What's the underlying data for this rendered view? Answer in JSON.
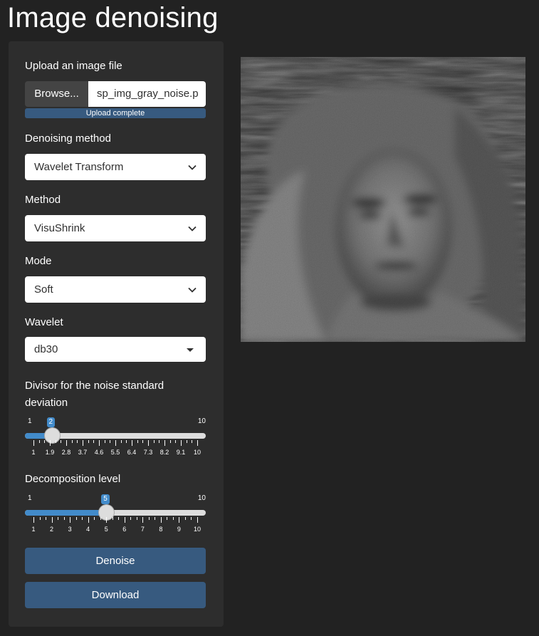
{
  "app": {
    "title": "Image denoising"
  },
  "upload": {
    "label": "Upload an image file",
    "browse_label": "Browse...",
    "file_name": "sp_img_gray_noise.p",
    "progress_text": "Upload complete",
    "progress": 1.0
  },
  "denoising_method": {
    "label": "Denoising method",
    "value": "Wavelet Transform",
    "icon": "chevron-down-icon"
  },
  "method": {
    "label": "Method",
    "value": "VisuShrink",
    "icon": "chevron-down-icon"
  },
  "mode": {
    "label": "Mode",
    "value": "Soft",
    "icon": "chevron-down-icon"
  },
  "wavelet": {
    "label": "Wavelet",
    "value": "db30",
    "icon": "caret-down-icon"
  },
  "noise_divisor": {
    "label": "Divisor for the noise standard deviation",
    "min": 1,
    "max": 10,
    "value": 2,
    "min_label": "1",
    "max_label": "10",
    "value_label": "2",
    "tick_labels": [
      "1",
      "1.9",
      "2.8",
      "3.7",
      "4.6",
      "5.5",
      "6.4",
      "7.3",
      "8.2",
      "9.1",
      "10"
    ]
  },
  "decomp_level": {
    "label": "Decomposition level",
    "min": 1,
    "max": 10,
    "value": 5,
    "min_label": "1",
    "max_label": "10",
    "value_label": "5",
    "tick_labels": [
      "1",
      "2",
      "3",
      "4",
      "5",
      "6",
      "7",
      "8",
      "9",
      "10"
    ]
  },
  "buttons": {
    "denoise": "Denoise",
    "download": "Download"
  },
  "colors": {
    "background": "#222222",
    "sidebar": "#2d2d2d",
    "accent": "#375a7f",
    "slider": "#428bca"
  }
}
